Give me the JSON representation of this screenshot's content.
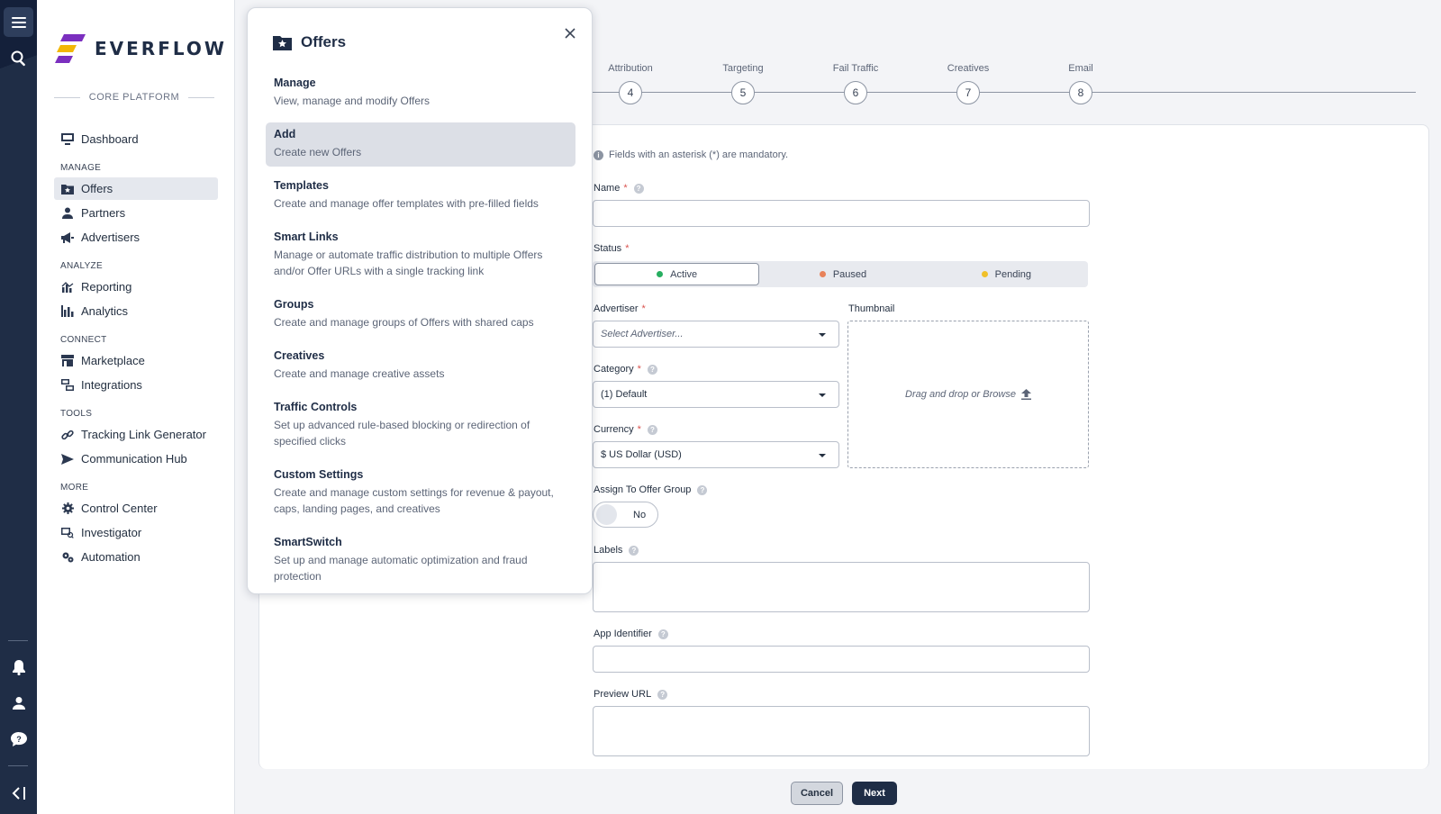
{
  "rail": {
    "icons": [
      "menu-icon",
      "search-icon",
      "bell-icon",
      "user-icon",
      "help-icon",
      "collapse-icon"
    ]
  },
  "sidebar": {
    "logo_text": "EVERFLOW",
    "platform_label": "CORE PLATFORM",
    "dashboard": "Dashboard",
    "sections": [
      {
        "title": "MANAGE",
        "items": [
          "Offers",
          "Partners",
          "Advertisers"
        ]
      },
      {
        "title": "ANALYZE",
        "items": [
          "Reporting",
          "Analytics"
        ]
      },
      {
        "title": "CONNECT",
        "items": [
          "Marketplace",
          "Integrations"
        ]
      },
      {
        "title": "TOOLS",
        "items": [
          "Tracking Link Generator",
          "Communication Hub"
        ]
      },
      {
        "title": "MORE",
        "items": [
          "Control Center",
          "Investigator",
          "Automation"
        ]
      }
    ]
  },
  "stepper": {
    "steps": [
      {
        "label": "Attribution",
        "num": "4"
      },
      {
        "label": "Targeting",
        "num": "5"
      },
      {
        "label": "Fail Traffic",
        "num": "6"
      },
      {
        "label": "Creatives",
        "num": "7"
      },
      {
        "label": "Email",
        "num": "8"
      }
    ]
  },
  "form": {
    "note": "Fields with an asterisk (*) are mandatory.",
    "name_label": "Name",
    "status_label": "Status",
    "status_options": [
      "Active",
      "Paused",
      "Pending"
    ],
    "status_colors": [
      "#27ae60",
      "#e8825a",
      "#f0c02a"
    ],
    "advertiser_label": "Advertiser",
    "advertiser_placeholder": "Select Advertiser...",
    "thumbnail_label": "Thumbnail",
    "dropzone_text": "Drag and drop or Browse",
    "category_label": "Category",
    "category_value": "(1) Default",
    "currency_label": "Currency",
    "currency_value": "$ US Dollar (USD)",
    "offer_group_label": "Assign To Offer Group",
    "offer_group_value": "No",
    "labels_label": "Labels",
    "app_identifier_label": "App Identifier",
    "preview_url_label": "Preview URL",
    "cancel": "Cancel",
    "next": "Next"
  },
  "panel": {
    "title": "Offers",
    "items": [
      {
        "title": "Manage",
        "desc": "View, manage and modify Offers"
      },
      {
        "title": "Add",
        "desc": "Create new Offers"
      },
      {
        "title": "Templates",
        "desc": "Create and manage offer templates with pre-filled fields"
      },
      {
        "title": "Smart Links",
        "desc": "Manage or automate traffic distribution to multiple Offers and/or Offer URLs with a single tracking link"
      },
      {
        "title": "Groups",
        "desc": "Create and manage groups of Offers with shared caps"
      },
      {
        "title": "Creatives",
        "desc": "Create and manage creative assets"
      },
      {
        "title": "Traffic Controls",
        "desc": "Set up advanced rule-based blocking or redirection of specified clicks"
      },
      {
        "title": "Custom Settings",
        "desc": "Create and manage custom settings for revenue & payout, caps, landing pages, and creatives"
      },
      {
        "title": "SmartSwitch",
        "desc": "Set up and manage automatic optimization and fraud protection"
      }
    ]
  }
}
